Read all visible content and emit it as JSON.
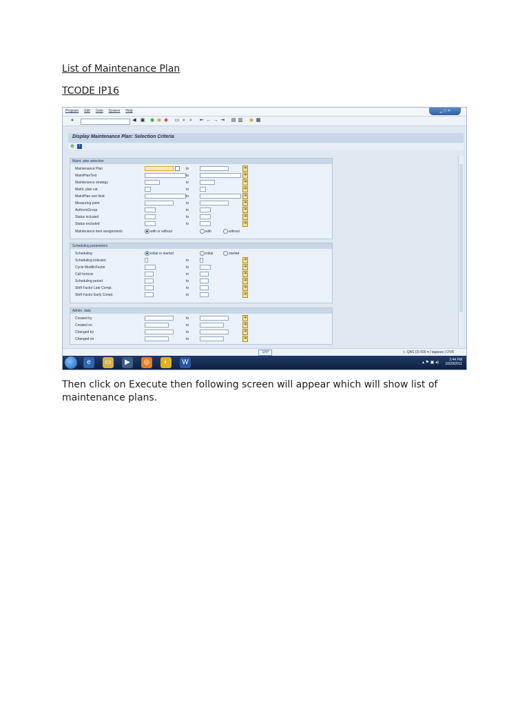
{
  "doc": {
    "heading1": "List of Maintenance Plan",
    "heading2": "TCODE IP16",
    "paragraph": "Then click on Execute then following screen will appear which will show list of maintenance plans."
  },
  "window": {
    "menu": [
      "Program",
      "Edit",
      "Goto",
      "System",
      "Help"
    ],
    "screen_title": "Display Maintenance Plan: Selection Criteria",
    "to_label": "to",
    "groups": {
      "maint": {
        "title": "Maint. plan selection",
        "rows": [
          "Maintenance Plan",
          "MaintPlanText",
          "Maintenance strategy",
          "Maint. plan cat.",
          "MaintPlan sort field",
          "Measuring point",
          "AuthorizGroup",
          "Status included",
          "Status excluded",
          "Maintenance item assignments"
        ],
        "radios": [
          "with or without",
          "with",
          "without"
        ]
      },
      "sched": {
        "title": "Scheduling parameters",
        "rows": [
          "Scheduling",
          "Scheduling indicator",
          "Cycle ModificFactor",
          "Call horizon",
          "Scheduling period",
          "Shift Factor Late Compl.",
          "Shift Factor Early Compl."
        ],
        "radios": [
          "initial or started",
          "initial",
          "started"
        ]
      },
      "admin": {
        "title": "Admin. data",
        "rows": [
          "Created by",
          "Created on",
          "Changed by",
          "Changed on"
        ]
      }
    },
    "status": {
      "system": "QAS (3) 600",
      "user": "tagasas",
      "mode": "OVR"
    },
    "taskbar": {
      "time": "2:44 PM",
      "date": "10/29/2011"
    }
  },
  "colors": {
    "window_bg": "#dfe8f1",
    "title_band": "#c9d8e8",
    "required_field": "#fdeab6",
    "taskbar": "#0f2142"
  }
}
